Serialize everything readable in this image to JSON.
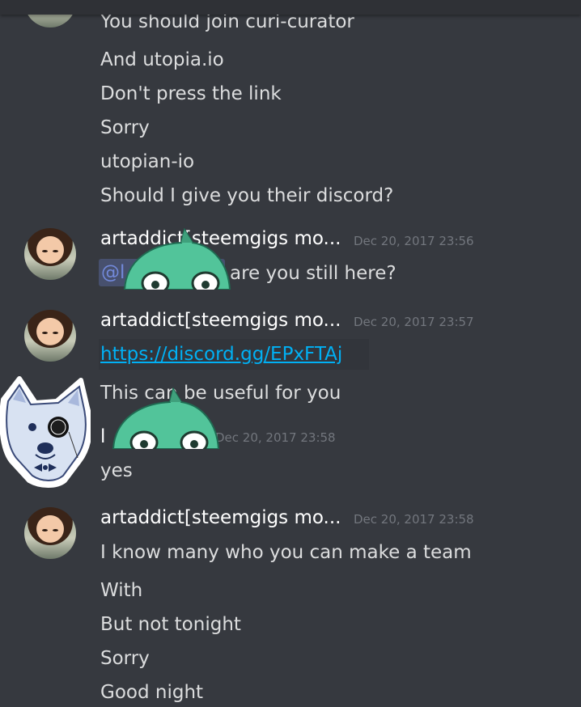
{
  "messages": {
    "group0": {
      "lines": [
        "You should join curi-curator",
        "And utopia.io",
        "Don't press the link",
        "Sorry",
        "utopian-io",
        "Should I give you their discord?"
      ]
    },
    "group1": {
      "username": "artaddict[steemgigs mo...",
      "timestamp": "Dec 20, 2017 23:56",
      "mention": "@l",
      "text": "are you still here?"
    },
    "group2": {
      "username": "artaddict[steemgigs mo...",
      "timestamp": "Dec 20, 2017 23:57",
      "link": "https://discord.gg/EPxFTAj",
      "text": "This can be useful for you"
    },
    "group3": {
      "username": "l",
      "timestamp": "Dec 20, 2017 23:58",
      "text": "yes"
    },
    "group4": {
      "username": "artaddict[steemgigs mo...",
      "timestamp": "Dec 20, 2017 23:58",
      "lines": [
        "I know many who you can make a team",
        "With",
        "But not tonight",
        "Sorry",
        "Good night"
      ]
    }
  },
  "colors": {
    "background": "#36393f",
    "text": "#dcddde",
    "username": "#ffffff",
    "timestamp": "#72767d",
    "link": "#00b0f4",
    "mention": "#7289da",
    "sticker_green": "#52c49a"
  },
  "icons": {
    "dino_sticker": "dinosaur-sticker-icon",
    "dog_avatar": "bulldog-avatar-icon"
  }
}
